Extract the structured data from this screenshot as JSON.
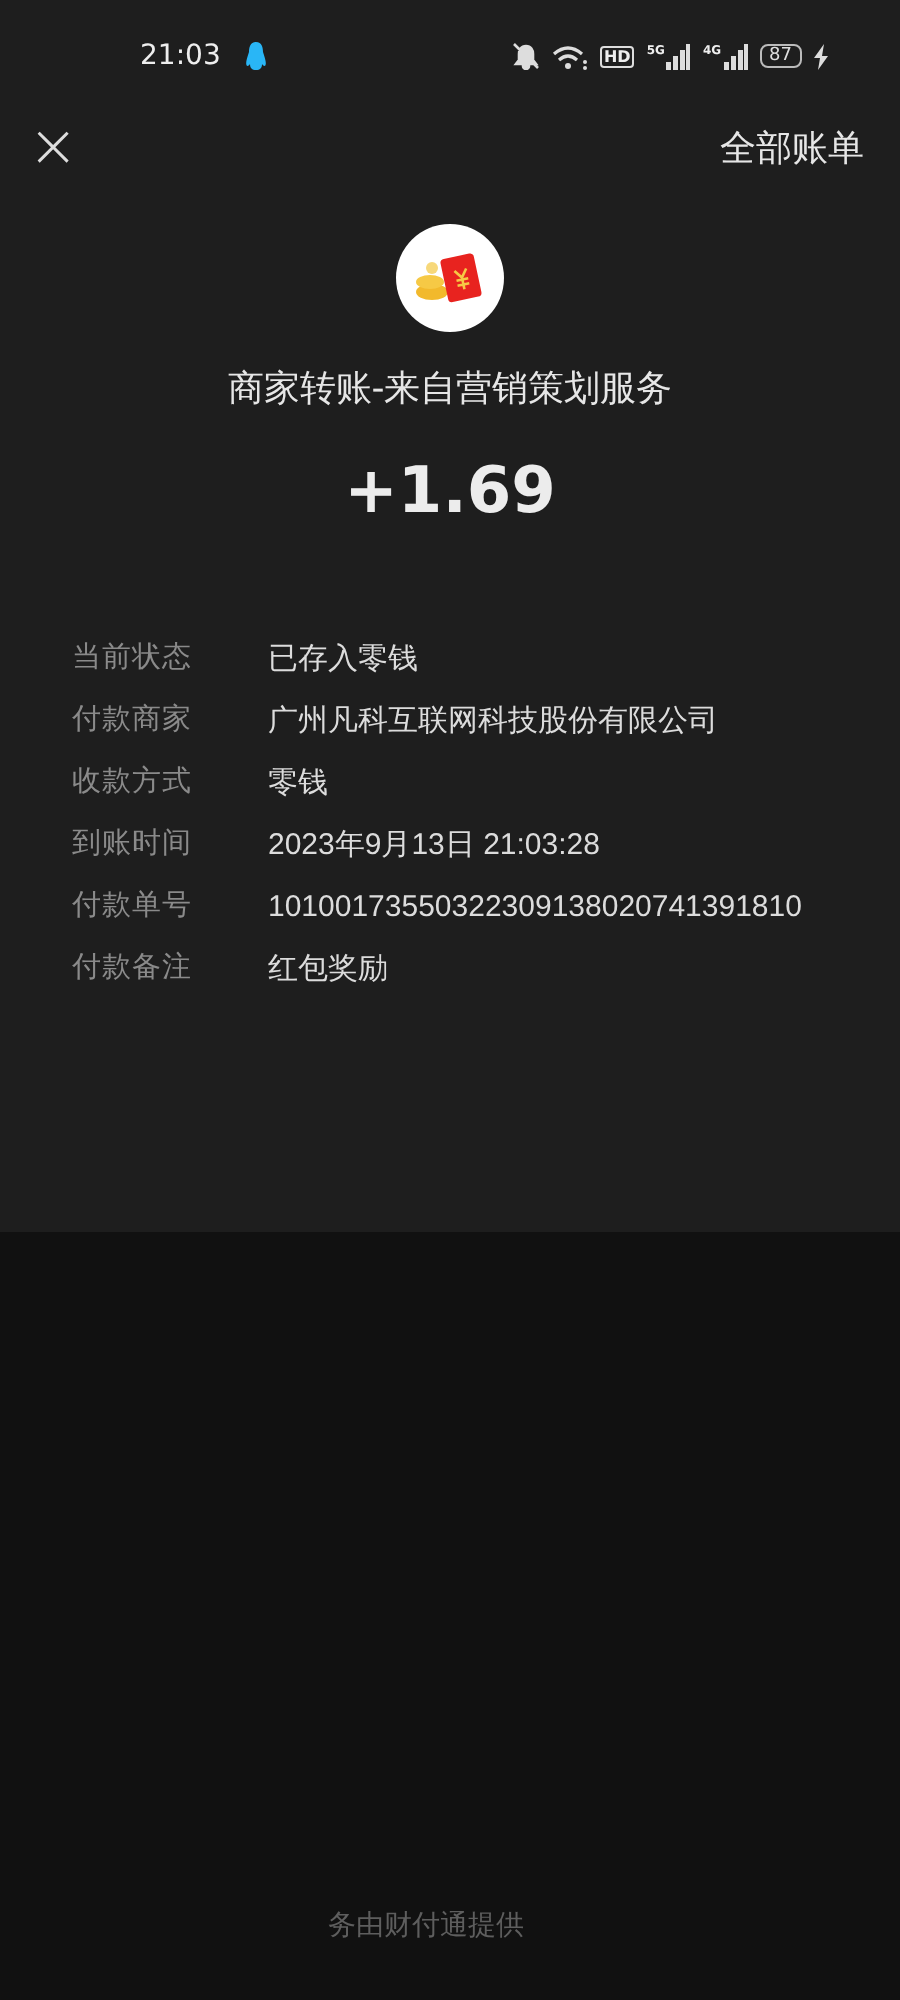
{
  "status_bar": {
    "time": "21:03",
    "hd_label": "HD",
    "sim_labels": [
      "5G",
      "4G"
    ],
    "battery": "87"
  },
  "top_bar": {
    "close": "×",
    "action": "全部账单"
  },
  "summary": {
    "title": "商家转账-来自营销策划服务",
    "amount": "+1.69"
  },
  "details": [
    {
      "label": "当前状态",
      "value": "已存入零钱"
    },
    {
      "label": "付款商家",
      "value": "广州凡科互联网科技股份有限公司"
    },
    {
      "label": "收款方式",
      "value": "零钱"
    },
    {
      "label": "到账时间",
      "value": "2023年9月13日 21:03:28"
    },
    {
      "label": "付款单号",
      "value": "10100173550322309138020741391810"
    },
    {
      "label": "付款备注",
      "value": "红包奖励"
    }
  ],
  "footer": "务由财付通提供"
}
